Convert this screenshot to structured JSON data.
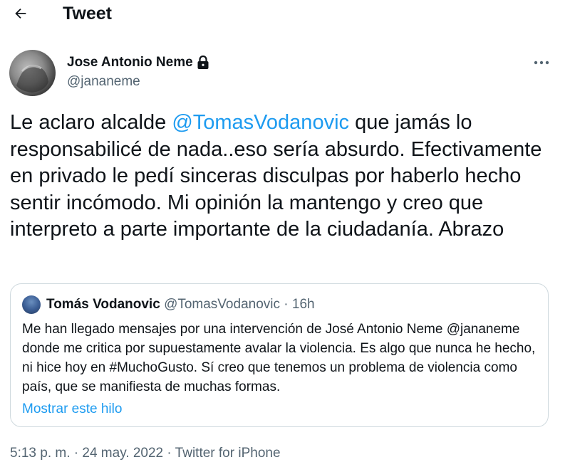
{
  "header": {
    "title": "Tweet",
    "back_icon": "arrow-left-icon"
  },
  "author": {
    "name": "Jose Antonio Neme",
    "handle": "@jananeme",
    "lock_icon": "lock-icon"
  },
  "more_icon": "more-horizontal-icon",
  "tweet": {
    "text_before": "Le aclaro alcalde ",
    "mention": "@TomasVodanovic",
    "text_after": " que jamás lo responsabilicé de nada..eso sería absurdo. Efectivamente en privado le pedí sinceras disculpas por haberlo hecho sentir incómodo. Mi opinión la mantengo y creo que interpreto a parte importante de la ciudadanía. Abrazo"
  },
  "quote": {
    "name": "Tomás Vodanovic",
    "handle": "@TomasVodanovic",
    "time": " · 16h",
    "text": "Me han llegado mensajes por una intervención de José Antonio Neme @jananeme donde me critica por supuestamente avalar la violencia. Es algo que nunca he hecho, ni hice hoy en #MuchoGusto. Sí creo que tenemos un problema de violencia como país, que se manifiesta de muchas formas.",
    "show_thread": "Mostrar este hilo"
  },
  "meta": {
    "time": "5:13 p. m.",
    "sep1": " · ",
    "date": "24 may. 2022",
    "sep2": " · ",
    "source": "Twitter for iPhone"
  },
  "colors": {
    "accent": "#1d9bf0",
    "text": "#0f1419",
    "secondary": "#536471",
    "border": "#cfd9de"
  }
}
